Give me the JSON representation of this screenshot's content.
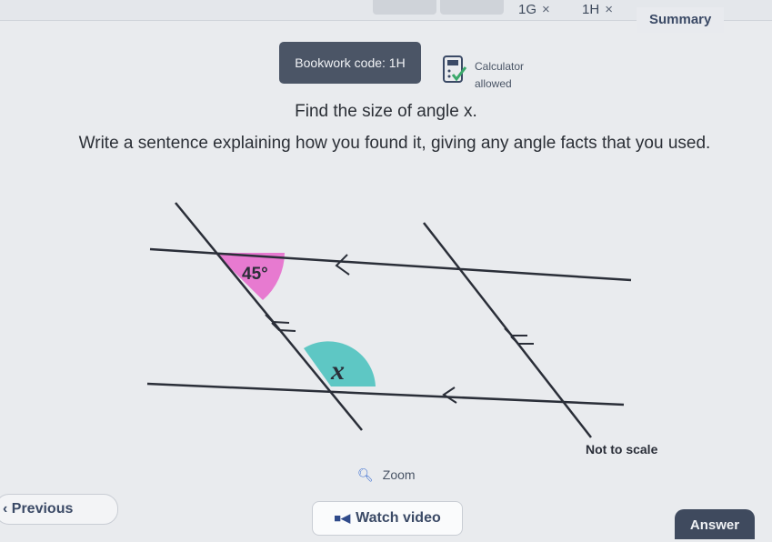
{
  "tabs": {
    "items": [
      {
        "label": "1G",
        "close": "×"
      },
      {
        "label": "1H",
        "close": "×"
      }
    ],
    "summary": "Summary"
  },
  "bookwork": {
    "label": "Bookwork code: 1H"
  },
  "calculator": {
    "line1": "Calculator",
    "line2": "allowed",
    "icon": "calculator-check-icon"
  },
  "question": {
    "line1": "Find the size of angle x.",
    "line2": "Write a sentence explaining how you found it, giving any angle facts that you used."
  },
  "diagram": {
    "angle_given": "45°",
    "angle_unknown": "x",
    "note": "Not to scale",
    "colors": {
      "given_sector": "#e77ad0",
      "unknown_sector": "#5ec7c4",
      "lines": "#2a2e38"
    }
  },
  "zoom": {
    "label": "Zoom",
    "icon": "search-icon"
  },
  "nav": {
    "previous": "Previous",
    "watch_video": "Watch video",
    "answer": "Answer"
  }
}
